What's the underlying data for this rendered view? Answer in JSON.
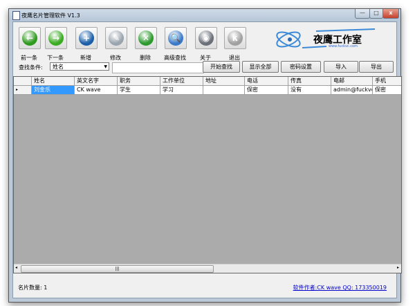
{
  "window": {
    "title": "夜鹰名片管理软件 V1.3",
    "minimize": "—",
    "maximize": "□",
    "close": "x"
  },
  "toolbar": [
    {
      "label": "前一条",
      "icon": "arrow-left",
      "glyph": "←",
      "color": "#2e9a1e"
    },
    {
      "label": "下一条",
      "icon": "arrow-right",
      "glyph": "→",
      "color": "#3aab22"
    },
    {
      "label": "新增",
      "icon": "add",
      "glyph": "+",
      "color": "#1b5fa8"
    },
    {
      "label": "修改",
      "icon": "edit",
      "glyph": "✎",
      "color": "#9aa4ae"
    },
    {
      "label": "删除",
      "icon": "delete",
      "glyph": "✕",
      "color": "#2e9a2e"
    },
    {
      "label": "高级查找",
      "icon": "search",
      "glyph": "🔍",
      "color": "#3a7ac8"
    },
    {
      "label": "关于",
      "icon": "about",
      "glyph": "◉",
      "color": "#6a6f78"
    },
    {
      "label": "退出",
      "icon": "exit",
      "glyph": "κ",
      "color": "#a0a0a0"
    }
  ],
  "logo": {
    "title": "夜鹰工作室",
    "url": "www.fuckvc.com"
  },
  "search": {
    "label": "查找条件:",
    "field": "姓名",
    "value": "",
    "buttons": [
      "开始查找",
      "显示全部",
      "密码设置",
      "导入",
      "导出"
    ]
  },
  "grid": {
    "columns": [
      "姓名",
      "英文名字",
      "职务",
      "工作单位",
      "地址",
      "电话",
      "传真",
      "电邮",
      "手机"
    ],
    "rows": [
      [
        "刘金乐",
        "CK wave",
        "学生",
        "学习",
        "",
        "保密",
        "没有",
        "admin@fuckvc...",
        "保密"
      ]
    ]
  },
  "status": {
    "count_label": "名片数量: 1",
    "author_link": "软件作者:CK wave QQ: 173350019"
  }
}
